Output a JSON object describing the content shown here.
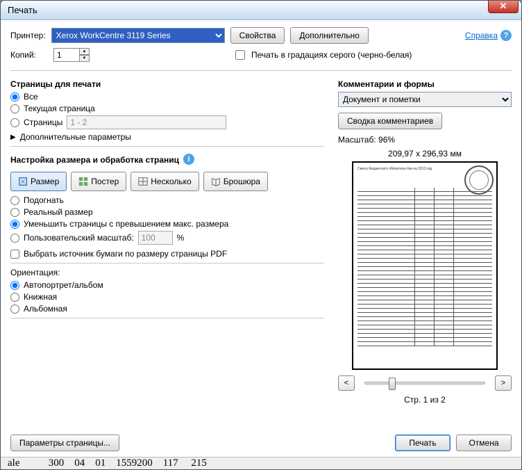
{
  "window": {
    "title": "Печать"
  },
  "top": {
    "printer_label": "Принтер:",
    "printer_value": "Xerox WorkCentre 3119 Series",
    "properties_btn": "Свойства",
    "advanced_btn": "Дополнительно",
    "help_link": "Справка",
    "copies_label": "Копий:",
    "copies_value": "1",
    "grayscale_label": "Печать в градациях серого (черно-белая)"
  },
  "pages": {
    "title": "Страницы для печати",
    "all": "Все",
    "current": "Текущая страница",
    "range_label": "Страницы",
    "range_value": "1 - 2",
    "more": "Дополнительные параметры"
  },
  "sizing": {
    "title": "Настройка размера и обработка страниц",
    "size_btn": "Размер",
    "poster_btn": "Постер",
    "multiple_btn": "Несколько",
    "booklet_btn": "Брошюра",
    "fit": "Подогнать",
    "actual": "Реальный размер",
    "shrink": "Уменьшить страницы с превышением макс. размера",
    "custom_label": "Пользовательский масштаб:",
    "custom_value": "100",
    "custom_pct": "%",
    "source_by_size": "Выбрать источник бумаги по размеру страницы PDF"
  },
  "orientation": {
    "title": "Ориентация:",
    "auto": "Автопортрет/альбом",
    "portrait": "Книжная",
    "landscape": "Альбомная"
  },
  "comments": {
    "title": "Комментарии и формы",
    "combo": "Документ и пометки",
    "summary_btn": "Сводка комментариев"
  },
  "preview": {
    "scale_label": "Масштаб:",
    "scale_value": "96%",
    "dimensions": "209,97 x 296,93 мм",
    "page_of": "Стр. 1 из 2"
  },
  "footer": {
    "page_setup": "Параметры страницы...",
    "print": "Печать",
    "cancel": "Отмена"
  },
  "behind": "ale           300    04    01    1559200    117     215"
}
